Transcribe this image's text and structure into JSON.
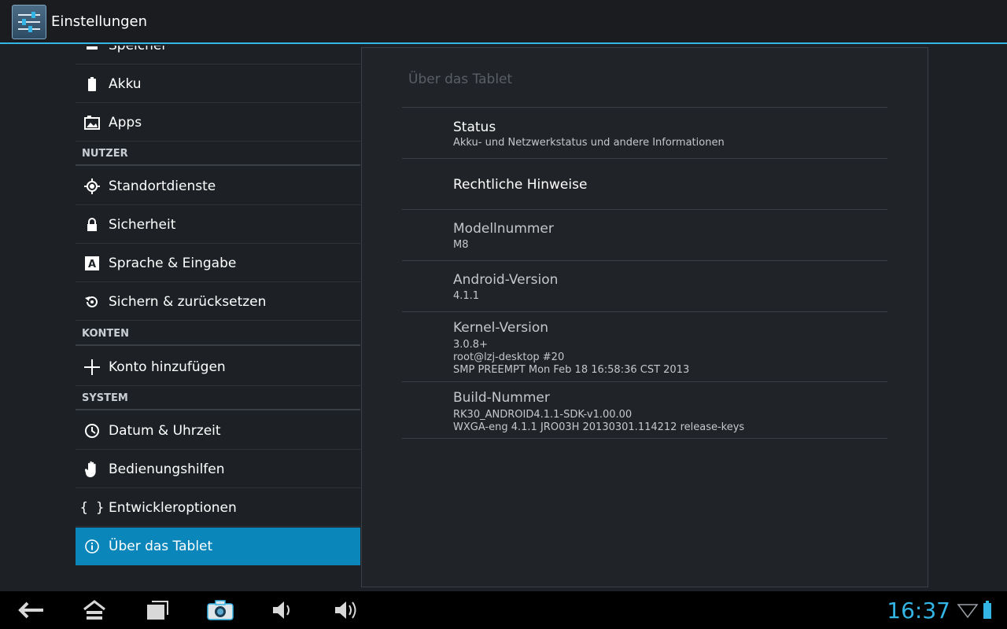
{
  "app": {
    "title": "Einstellungen"
  },
  "sidebar": {
    "items": [
      {
        "label": "Speicher",
        "icon": "storage-icon"
      },
      {
        "label": "Akku",
        "icon": "battery-icon"
      },
      {
        "label": "Apps",
        "icon": "apps-icon"
      }
    ],
    "sections": [
      {
        "header": "NUTZER",
        "items": [
          {
            "label": "Standortdienste",
            "icon": "location-icon"
          },
          {
            "label": "Sicherheit",
            "icon": "lock-icon"
          },
          {
            "label": "Sprache & Eingabe",
            "icon": "language-icon"
          },
          {
            "label": "Sichern & zurücksetzen",
            "icon": "backup-icon"
          }
        ]
      },
      {
        "header": "KONTEN",
        "items": [
          {
            "label": "Konto hinzufügen",
            "icon": "add-icon"
          }
        ]
      },
      {
        "header": "SYSTEM",
        "items": [
          {
            "label": "Datum & Uhrzeit",
            "icon": "clock-icon"
          },
          {
            "label": "Bedienungshilfen",
            "icon": "hand-icon"
          },
          {
            "label": "Entwickleroptionen",
            "icon": "braces-icon"
          },
          {
            "label": "Über das Tablet",
            "icon": "info-icon",
            "selected": true
          }
        ]
      }
    ]
  },
  "detail": {
    "title": "Über das Tablet",
    "prefs": [
      {
        "title": "Status",
        "summary": [
          "Akku- und Netzwerkstatus und andere Informationen"
        ]
      },
      {
        "title": "Rechtliche Hinweise",
        "summary": []
      },
      {
        "title": "Modellnummer",
        "summary": [
          "M8"
        ]
      },
      {
        "title": "Android-Version",
        "summary": [
          "4.1.1"
        ]
      },
      {
        "title": "Kernel-Version",
        "summary": [
          "3.0.8+",
          "root@lzj-desktop #20",
          "SMP PREEMPT Mon Feb 18 16:58:36 CST 2013"
        ]
      },
      {
        "title": "Build-Nummer",
        "summary": [
          "RK30_ANDROID4.1.1-SDK-v1.00.00",
          "WXGA-eng 4.1.1 JRO03H 20130301.114212 release-keys"
        ]
      }
    ]
  },
  "statusbar": {
    "time": "16:37"
  },
  "colors": {
    "accent": "#33b5e5",
    "selected": "#0a86bb",
    "background": "#1d2126"
  }
}
